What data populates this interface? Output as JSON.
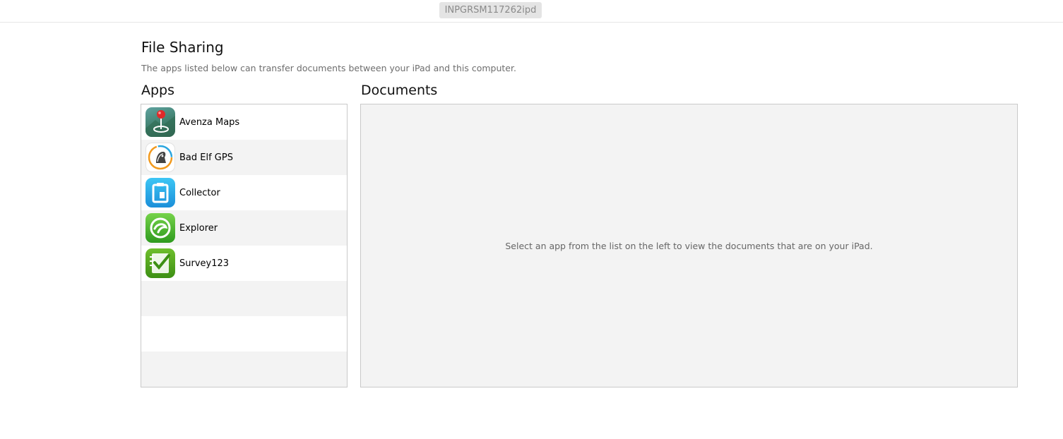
{
  "header": {
    "device_name": "INPGRSM117262ipd"
  },
  "file_sharing": {
    "title": "File Sharing",
    "description": "The apps listed below can transfer documents between your iPad and this computer."
  },
  "apps": {
    "heading": "Apps",
    "items": [
      {
        "label": "Avenza Maps",
        "icon": "avenza-maps-icon"
      },
      {
        "label": "Bad Elf GPS",
        "icon": "bad-elf-gps-icon"
      },
      {
        "label": "Collector",
        "icon": "collector-icon"
      },
      {
        "label": "Explorer",
        "icon": "explorer-icon"
      },
      {
        "label": "Survey123",
        "icon": "survey123-icon"
      }
    ]
  },
  "documents": {
    "heading": "Documents",
    "empty_message": "Select an app from the list on the left to view the documents that are on your iPad."
  }
}
